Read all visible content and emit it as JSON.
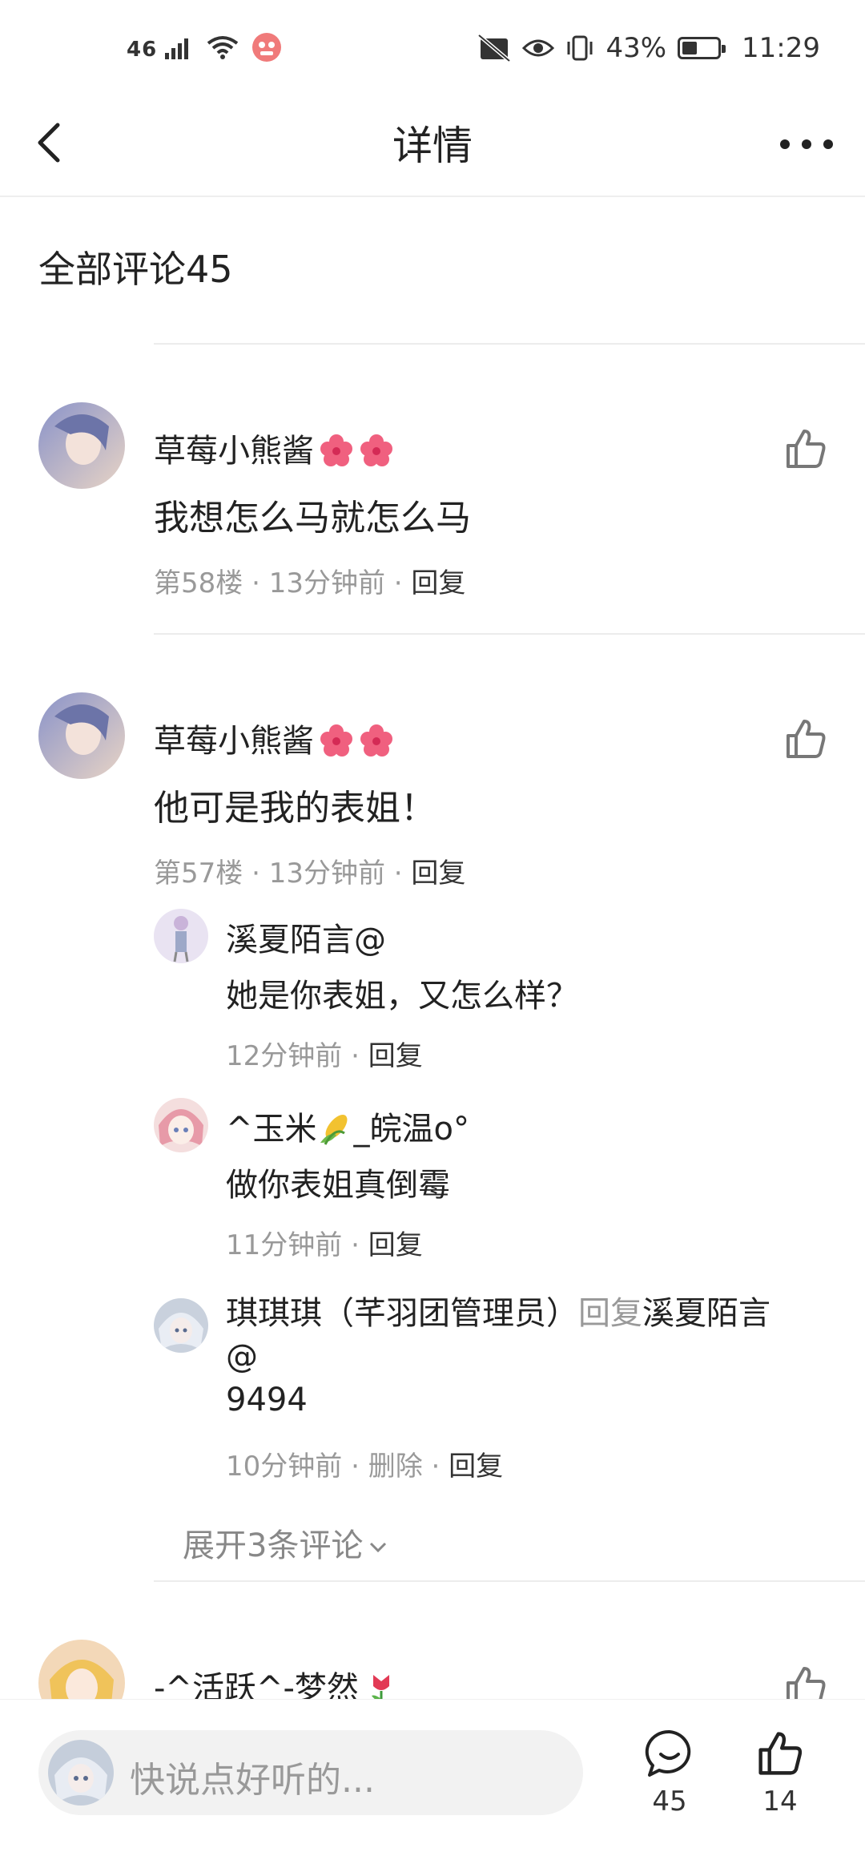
{
  "status_bar": {
    "signal_label": "46",
    "battery": "43%",
    "battery_level": 0.43,
    "time": "11:29"
  },
  "header": {
    "title": "详情"
  },
  "comments_header": {
    "label": "全部评论",
    "count": "45"
  },
  "comments": [
    {
      "name": "草莓小熊酱",
      "text": "我想怎么马就怎么马",
      "floor": "第58楼",
      "time": "13分钟前",
      "reply_label": "回复"
    },
    {
      "name": "草莓小熊酱",
      "text": "他可是我的表姐！",
      "floor": "第57楼",
      "time": "13分钟前",
      "reply_label": "回复",
      "replies": [
        {
          "name": "溪夏陌言@",
          "text": "她是你表姐，又怎么样？",
          "time": "12分钟前",
          "reply_label": "回复"
        },
        {
          "name_prefix": "^玉米",
          "name_suffix": "_皖温o°",
          "text": "做你表姐真倒霉",
          "time": "11分钟前",
          "reply_label": "回复"
        },
        {
          "name": "琪琪琪（芊羽团管理员）",
          "reply_word": "回复",
          "target": "溪夏陌言",
          "target_line2": "@",
          "text": "9494",
          "time": "10分钟前",
          "delete_label": "删除",
          "reply_label": "回复"
        }
      ],
      "expand_label": "展开3条评论"
    },
    {
      "name": "-^活跃^-梦然"
    }
  ],
  "bottom_bar": {
    "placeholder": "快说点好听的...",
    "comment_count": "45",
    "like_count": "14"
  }
}
